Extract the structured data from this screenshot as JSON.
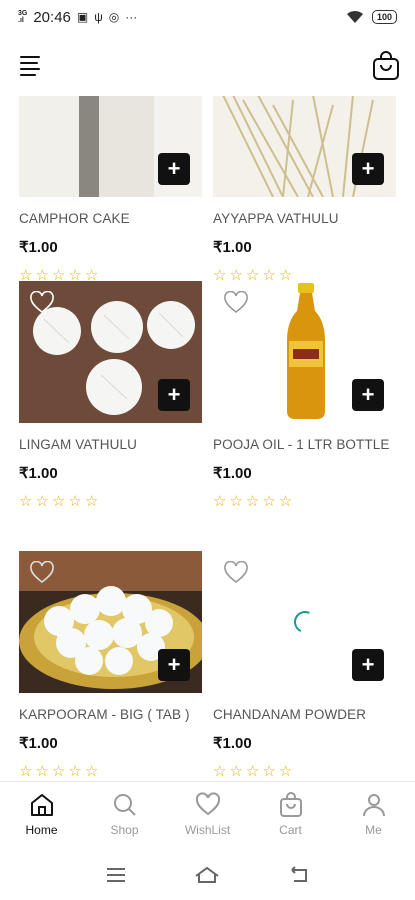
{
  "status_bar": {
    "signal": "3G",
    "time": "20:46",
    "battery": "100"
  },
  "products": [
    {
      "name": "CAMPHOR CAKE",
      "price": "₹1.00",
      "rating": 0
    },
    {
      "name": "AYYAPPA VATHULU",
      "price": "₹1.00",
      "rating": 0
    },
    {
      "name": "LINGAM VATHULU",
      "price": "₹1.00",
      "rating": 0
    },
    {
      "name": "POOJA OIL - 1 LTR BOTTLE",
      "price": "₹1.00",
      "rating": 0
    },
    {
      "name": "KARPOORAM - BIG ( TAB )",
      "price": "₹1.00",
      "rating": 0
    },
    {
      "name": "CHANDANAM POWDER",
      "price": "₹1.00",
      "rating": 0
    }
  ],
  "add_label": "+",
  "star_glyph": "☆",
  "bottom_nav": [
    {
      "label": "Home",
      "icon": "home-icon",
      "active": true
    },
    {
      "label": "Shop",
      "icon": "search-icon",
      "active": false
    },
    {
      "label": "WishList",
      "icon": "heart-icon",
      "active": false
    },
    {
      "label": "Cart",
      "icon": "bag-icon",
      "active": false
    },
    {
      "label": "Me",
      "icon": "user-icon",
      "active": false
    }
  ],
  "colors": {
    "star": "#e8b400",
    "spinner": "#1a9a8a",
    "add_button": "#111111"
  }
}
